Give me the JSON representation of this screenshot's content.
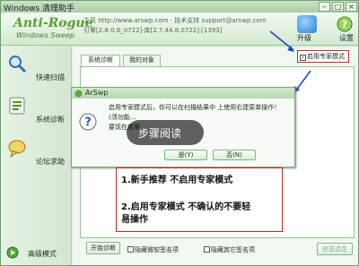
{
  "titlebar": {
    "title": "Windows 清理助手"
  },
  "header": {
    "logo_line1": "Anti-Rogue",
    "logo_line2": "Windows Sweep",
    "info_line1": "主页 http://www.arswp.com · 技术支持 support@arswp.com",
    "info_line2": "引擎[2.8.0.8_0722]·库[2.7.44.8.0722]·[1393]",
    "upgrade_label": "升级",
    "settings_label": "设置"
  },
  "sidebar": {
    "items": [
      {
        "label": "快速扫描"
      },
      {
        "label": "系统诊断"
      },
      {
        "label": "论坛求助"
      }
    ],
    "advanced_label": "高级模式"
  },
  "tabs": [
    {
      "label": "系统诊断"
    },
    {
      "label": "我的对象"
    }
  ],
  "expert_mode": {
    "label": "启用专家模式",
    "checked": true
  },
  "dialog": {
    "title": "ArSwp",
    "message_line1": "启用专家模式后，你可以在扫描结果中 上使用右建菜单操作！",
    "message_line2": "(须功能…",
    "message_line3": "要现在启用…",
    "overlay_text": "步骤阅读",
    "yes_label": "是(Y)",
    "no_label": "否(N)"
  },
  "note": {
    "line1": "1.新手推荐 不启用专家模式",
    "line2": "2.启用专家模式 不确认的不要轻",
    "line3": "易操作"
  },
  "bottom": {
    "start_label": "开始诊断",
    "hide_micro_label": "隐藏微软签名项",
    "hide_other_label": "隐藏其它签名项",
    "repair_label": "修复选定"
  },
  "colors": {
    "accent": "#5c9c3a",
    "frame": "#6e9f6e",
    "note_border": "#c52a2a",
    "arrow": "#1e3ec8"
  }
}
